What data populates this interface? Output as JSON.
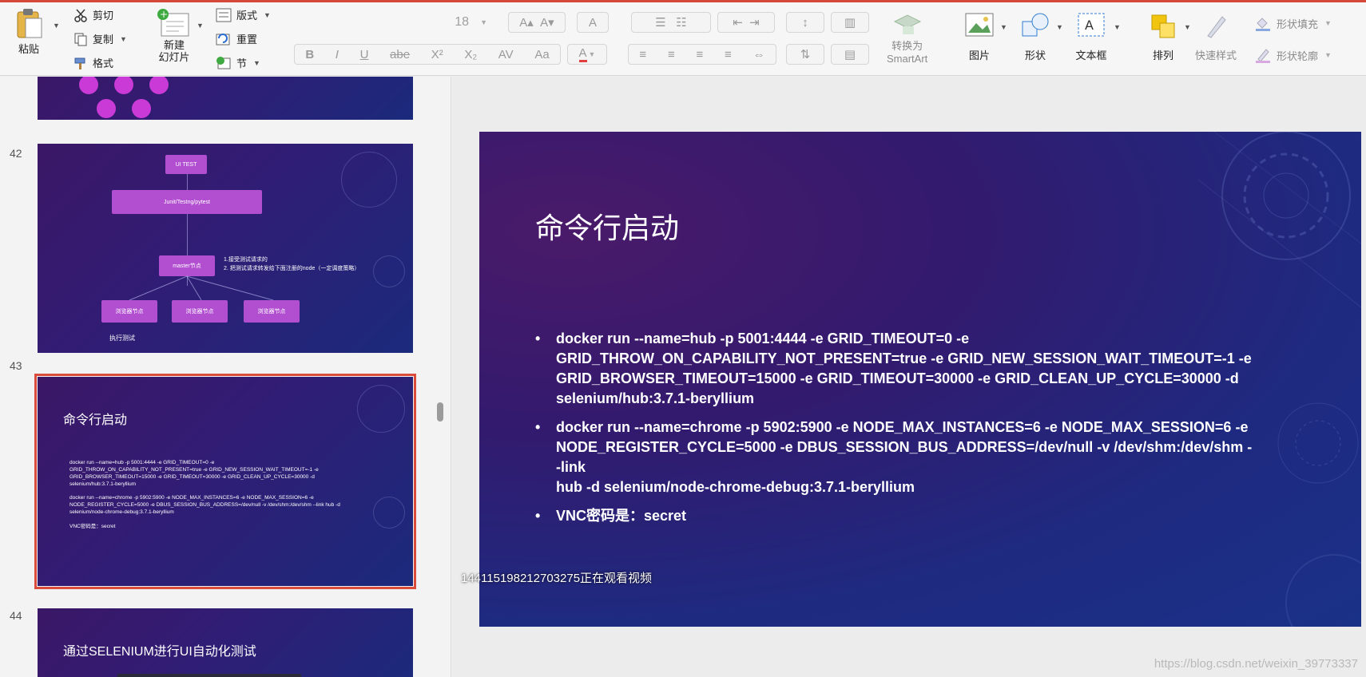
{
  "ribbon": {
    "paste": "粘贴",
    "cut": "剪切",
    "copy": "复制",
    "format": "格式",
    "new_slide_1": "新建",
    "new_slide_2": "幻灯片",
    "layout": "版式",
    "reset": "重置",
    "section": "节",
    "font_size": "18",
    "convert_1": "转换为",
    "convert_2": "SmartArt",
    "picture": "图片",
    "shape": "形状",
    "textbox": "文本框",
    "arrange": "排列",
    "quick_styles": "快速样式",
    "shape_fill": "形状填充",
    "shape_outline": "形状轮廓"
  },
  "thumbnails": {
    "s42_num": "42",
    "s42_uitest": "UI TEST",
    "s42_junit": "Junit/Testng/pytest",
    "s42_master": "master节点",
    "s42_note1": "1.接受测试请求的",
    "s42_note2": "2. 把测试请求转发给下面注册的node（一定调度策略）",
    "s42_browser": "浏览器节点",
    "s42_exec": "执行测试",
    "s43_num": "43",
    "s43_title": "命令行启动",
    "s43_b1": "docker run --name=hub -p 5001:4444 -e GRID_TIMEOUT=0 -e GRID_THROW_ON_CAPABILITY_NOT_PRESENT=true -e GRID_NEW_SESSION_WAIT_TIMEOUT=-1 -e GRID_BROWSER_TIMEOUT=15000 -e GRID_TIMEOUT=30000 -e GRID_CLEAN_UP_CYCLE=30000 -d selenium/hub:3.7.1-beryllium",
    "s43_b2": "docker run --name=chrome -p 5902:5900 -e NODE_MAX_INSTANCES=6 -e NODE_MAX_SESSION=6 -e NODE_REGISTER_CYCLE=5000 -e DBUS_SESSION_BUS_ADDRESS=/dev/null -v /dev/shm:/dev/shm --link hub -d selenium/node-chrome-debug:3.7.1-beryllium",
    "s43_b3": "VNC密码是：secret",
    "s44_num": "44",
    "s44_title": "通过SELENIUM进行UI自动化测试"
  },
  "slide": {
    "title": "命令行启动",
    "bullet1_l1": "docker run --name=hub -p 5001:4444 -e GRID_TIMEOUT=0 -e",
    "bullet1_l2": "GRID_THROW_ON_CAPABILITY_NOT_PRESENT=true -e GRID_NEW_SESSION_WAIT_TIMEOUT=-1 -e",
    "bullet1_l3": "GRID_BROWSER_TIMEOUT=15000 -e GRID_TIMEOUT=30000 -e GRID_CLEAN_UP_CYCLE=30000 -d",
    "bullet1_l4": "selenium/hub:3.7.1-beryllium",
    "bullet2_l1": "docker run --name=chrome -p 5902:5900 -e NODE_MAX_INSTANCES=6 -e NODE_MAX_SESSION=6 -e",
    "bullet2_l2": "NODE_REGISTER_CYCLE=5000 -e DBUS_SESSION_BUS_ADDRESS=/dev/null -v /dev/shm:/dev/shm --link",
    "bullet2_l3": "hub -d selenium/node-chrome-debug:3.7.1-beryllium",
    "bullet3": "VNC密码是：secret"
  },
  "overlay": "144115198212703275正在观看视频",
  "watermark": "https://blog.csdn.net/weixin_39773337",
  "colors": {
    "accent": "#d94b3a",
    "slide_bg": "#2b1e78",
    "node_box": "#b24fd0"
  }
}
